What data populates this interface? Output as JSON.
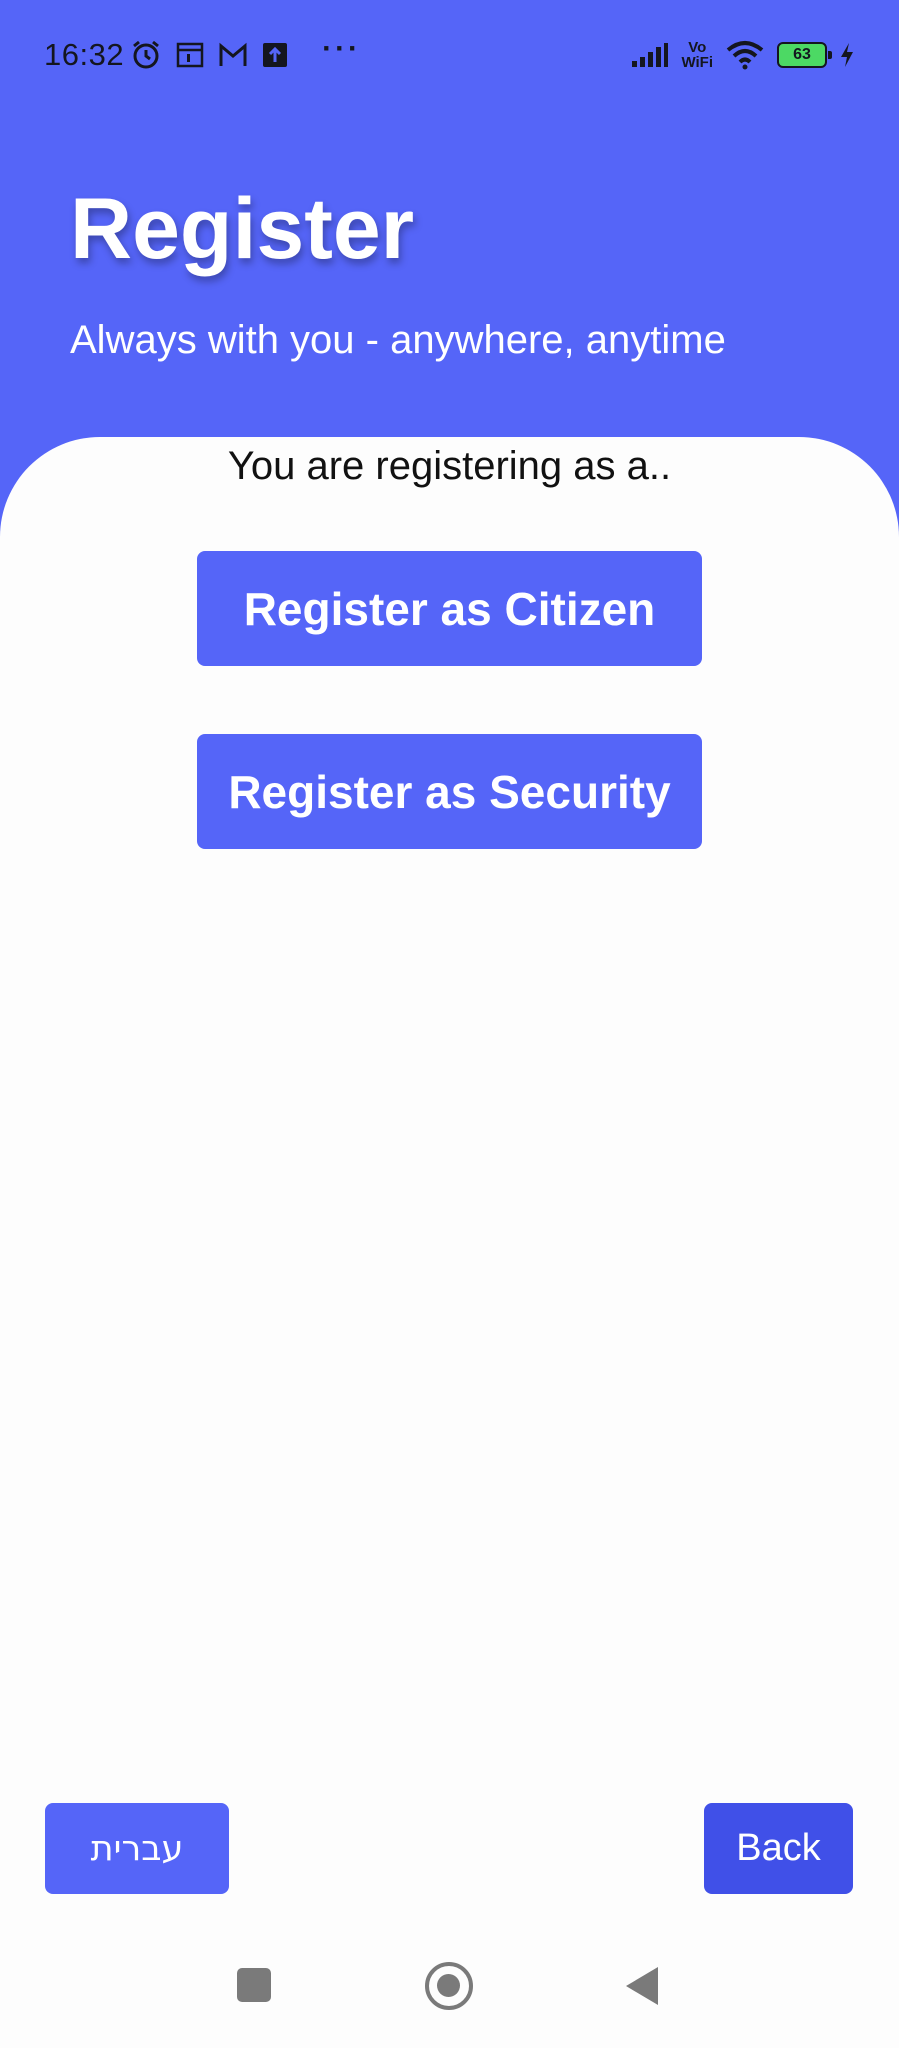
{
  "status_bar": {
    "time": "16:32",
    "left_icons": [
      "alarm-icon",
      "calendar-icon",
      "gmail-icon",
      "upload-icon"
    ],
    "overflow": "···",
    "volte_line1": "Vo",
    "volte_line2": "WiFi",
    "battery_level": "63"
  },
  "header": {
    "title": "Register",
    "subtitle": "Always with you - anywhere, anytime",
    "color": "#5565f8"
  },
  "main": {
    "prompt": "You are registering as a..",
    "citizen_button": "Register as Citizen",
    "security_button": "Register as Security"
  },
  "footer": {
    "language_button": "עברית",
    "back_button": "Back"
  },
  "nav_bar": {
    "icons": [
      "recents-icon",
      "home-icon",
      "back-icon"
    ]
  }
}
